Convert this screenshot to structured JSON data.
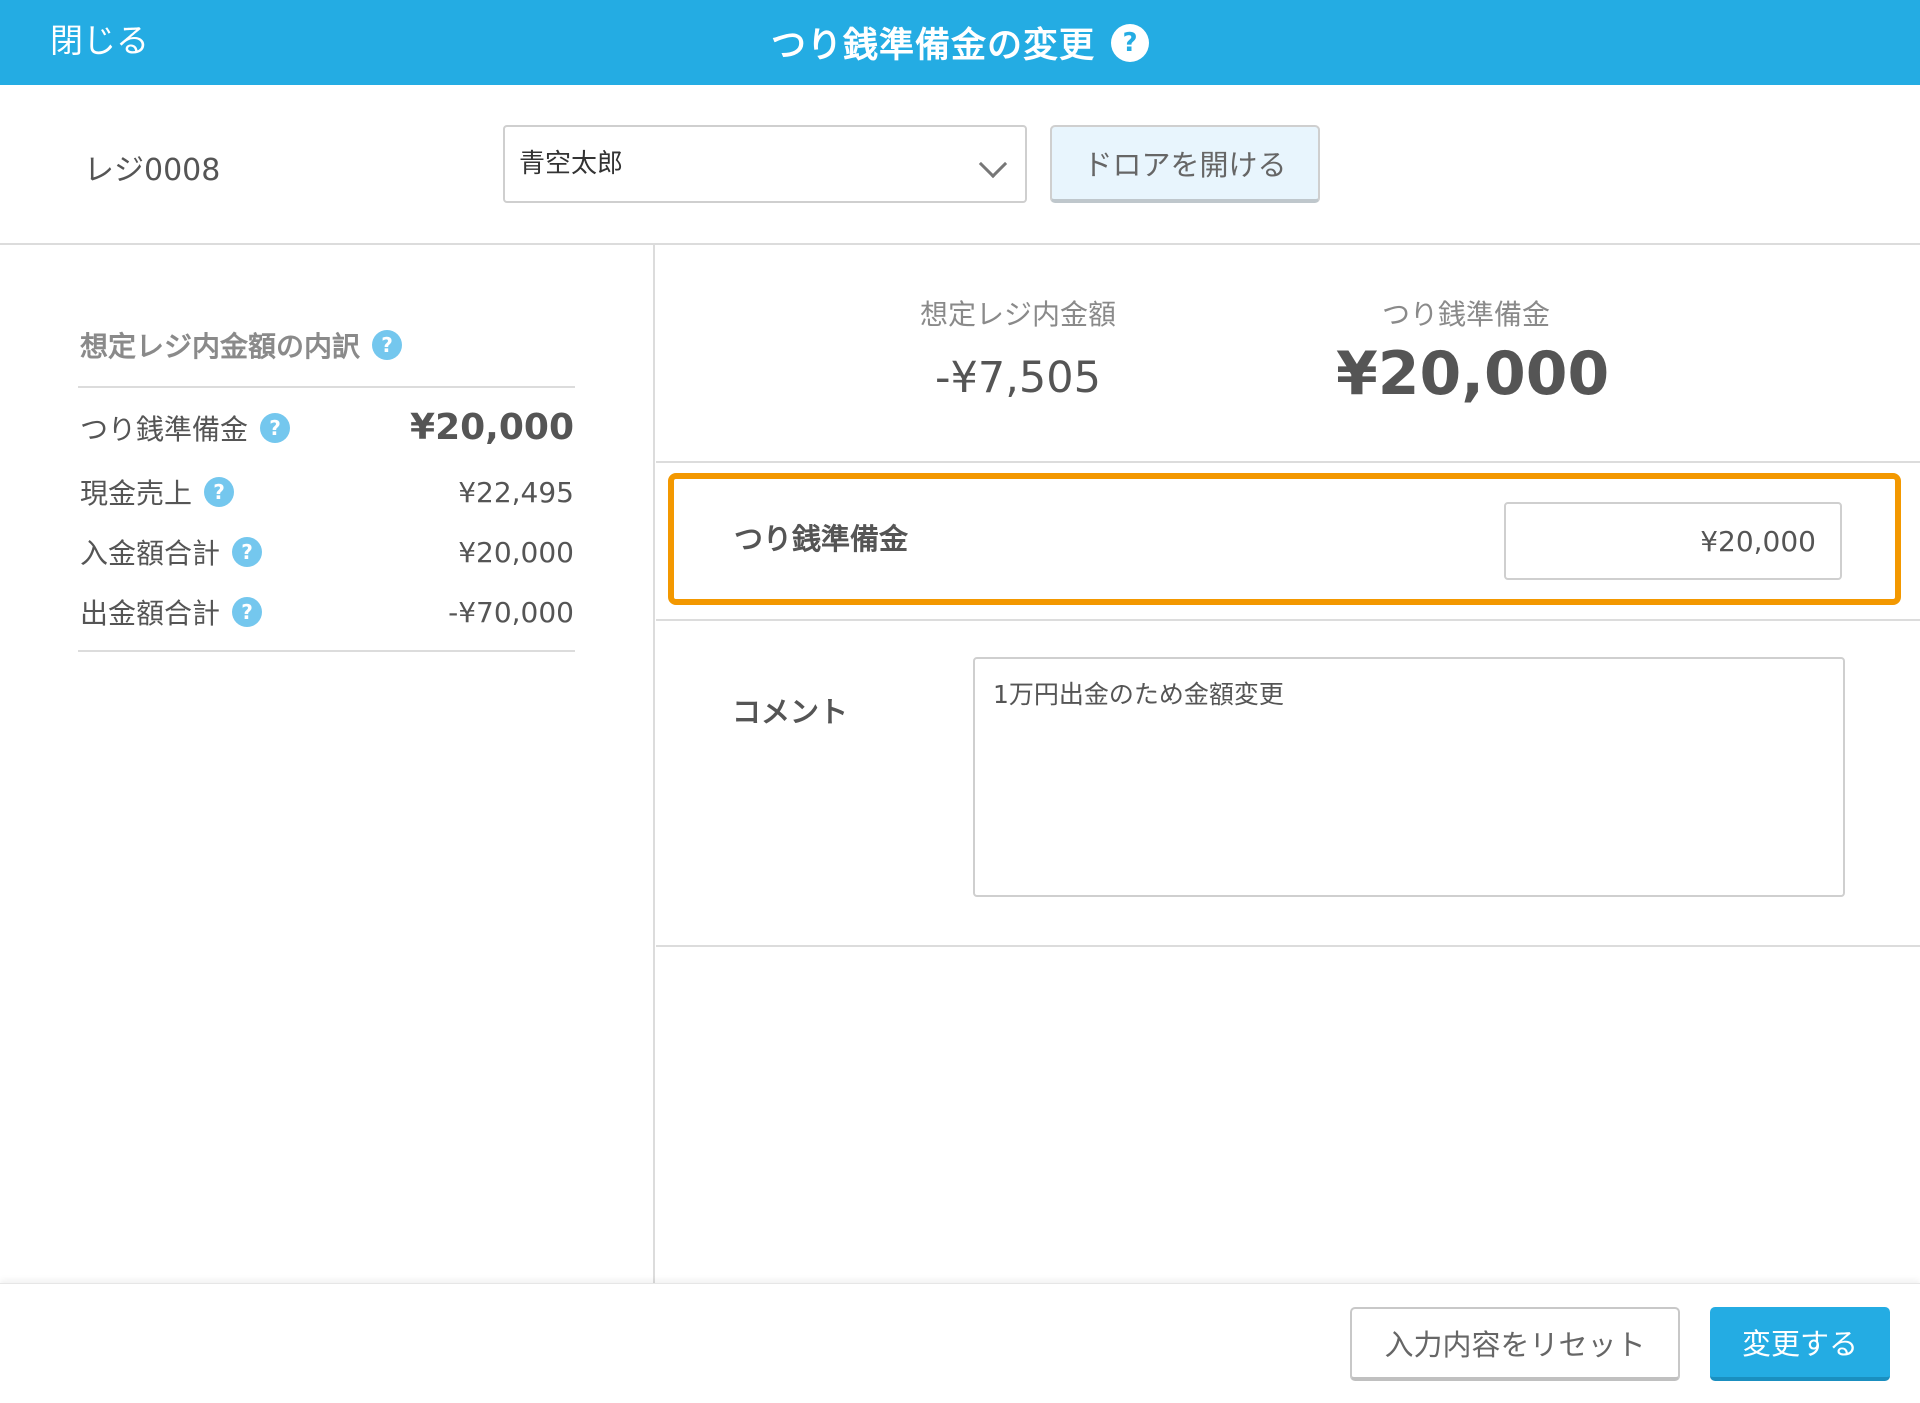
{
  "header": {
    "close_label": "閉じる",
    "title": "つり銭準備金の変更",
    "help_icon": "?"
  },
  "topbar": {
    "register_id": "レジ0008",
    "staff_select": {
      "value": "青空太郎"
    },
    "drawer_button": "ドロアを開ける"
  },
  "breakdown": {
    "title": "想定レジ内金額の内訳",
    "rows": [
      {
        "label": "つり銭準備金",
        "value": "¥20,000"
      },
      {
        "label": "現金売上",
        "value": "¥22,495"
      },
      {
        "label": "入金額合計",
        "value": "¥20,000"
      },
      {
        "label": "出金額合計",
        "value": "-¥70,000"
      }
    ]
  },
  "summary": {
    "expected_label": "想定レジ内金額",
    "expected_value": "-¥7,505",
    "float_label": "つり銭準備金",
    "float_value": "¥20,000"
  },
  "form": {
    "float_field_label": "つり銭準備金",
    "float_field_value": "¥20,000",
    "comment_label": "コメント",
    "comment_value": "1万円出金のため金額変更"
  },
  "footer": {
    "reset_label": "入力内容をリセット",
    "submit_label": "変更する"
  },
  "colors": {
    "header_bg": "#24ace3",
    "help_icon": "#74c7ee",
    "highlight_border": "#f39800",
    "primary_button": "#24ace3"
  }
}
